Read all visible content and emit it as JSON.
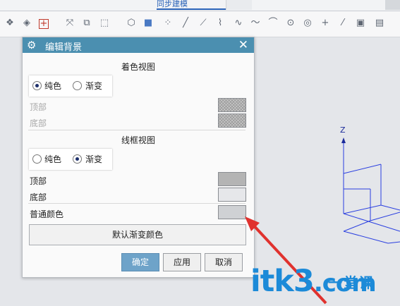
{
  "ribbon": {
    "active_tab": "同步建模"
  },
  "toolbar": {
    "icons": [
      "shaded-icon",
      "wireframe-icon",
      "add-icon",
      "move-icon",
      "copy-icon",
      "select-box-icon",
      "cube-icon",
      "solid-cube-icon",
      "points-icon",
      "line-icon",
      "line-icon-2",
      "curve-icon",
      "spline-icon",
      "wave-icon",
      "arc-icon",
      "circle-icon",
      "circle-target-icon",
      "plus-icon",
      "slash-icon",
      "image-icon",
      "book-icon"
    ]
  },
  "dialog": {
    "title": "编辑背景",
    "close_symbol": "✕",
    "shaded": {
      "heading": "着色视图",
      "radio_solid": "纯色",
      "radio_gradient": "渐变",
      "selected": "solid",
      "top_label": "顶部",
      "bottom_label": "底部"
    },
    "wireframe": {
      "heading": "线框视图",
      "radio_solid": "纯色",
      "radio_gradient": "渐变",
      "selected": "gradient",
      "top_label": "顶部",
      "bottom_label": "底部",
      "normal_color_label": "普通颜色"
    },
    "default_gradient_button": "默认渐变颜色",
    "ok_button": "确定",
    "apply_button": "应用",
    "cancel_button": "取消",
    "colors": {
      "wire_top": "#b4b4b4",
      "wire_bottom": "#e6e7ea",
      "normal": "#cfd1d4"
    }
  },
  "viewport": {
    "axis_label": "Z"
  },
  "watermark": {
    "text": "itk3",
    "sub": "一堂课",
    "domain": ".com"
  }
}
